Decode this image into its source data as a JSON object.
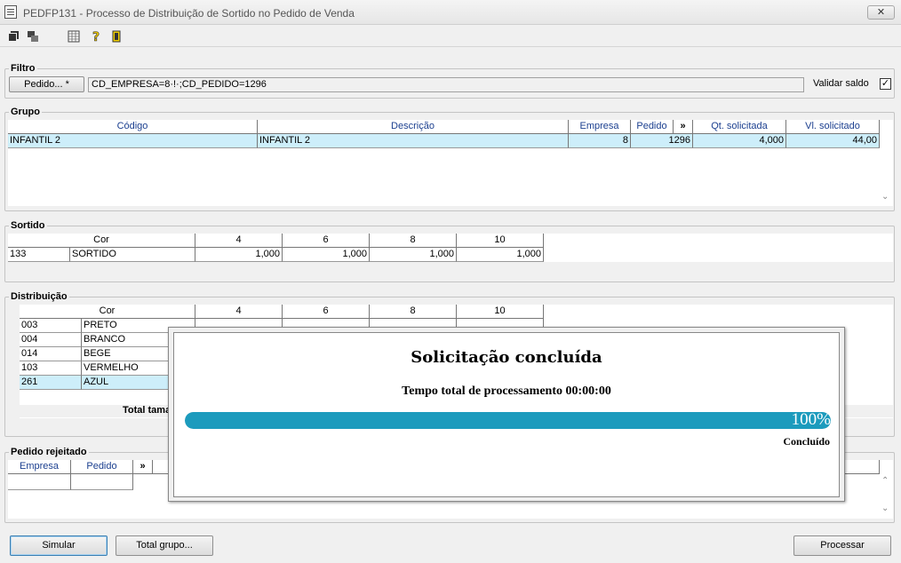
{
  "window": {
    "title": "PEDFP131 - Processo de Distribuição de Sortido no Pedido de Venda",
    "close_glyph": "✕"
  },
  "filtro": {
    "title": "Filtro",
    "pedido_button": "Pedido... *",
    "filter_value": "CD_EMPRESA=8·!·;CD_PEDIDO=1296",
    "validar_label": "Validar saldo",
    "validar_checked": "✓"
  },
  "grupo": {
    "title": "Grupo",
    "columns": [
      "Código",
      "Descrição",
      "Empresa",
      "Pedido",
      "»",
      "Qt. solicitada",
      "Vl. solicitado"
    ],
    "rows": [
      [
        "INFANTIL 2",
        "INFANTIL 2",
        "8",
        "1296",
        "4,000",
        "44,00"
      ]
    ]
  },
  "sortido": {
    "title": "Sortido",
    "columns": [
      "Cor",
      "4",
      "6",
      "8",
      "10"
    ],
    "rows": [
      [
        "133",
        "SORTIDO",
        "1,000",
        "1,000",
        "1,000",
        "1,000"
      ]
    ]
  },
  "distribuicao": {
    "title": "Distribuição",
    "columns": [
      "Cor",
      "4",
      "6",
      "8",
      "10"
    ],
    "rows": [
      [
        "003",
        "PRETO"
      ],
      [
        "004",
        "BRANCO"
      ],
      [
        "014",
        "BEGE"
      ],
      [
        "103",
        "VERMELHO"
      ],
      [
        "261",
        "AZUL"
      ]
    ],
    "total_label": "Total tama"
  },
  "rejeitado": {
    "title": "Pedido rejeitado",
    "columns": [
      "Empresa",
      "Pedido",
      "»"
    ]
  },
  "buttons": {
    "simular": "Simular",
    "total_grupo": "Total grupo...",
    "processar": "Processar"
  },
  "modal": {
    "title": "Solicitação concluída",
    "time": "Tempo total de processamento 00:00:00",
    "percent": "100%",
    "progress": 1.0,
    "status": "Concluído"
  },
  "colors": {
    "progress": "#1c9bbd",
    "selection": "#cdeefa",
    "header_text": "#1b3f8f"
  }
}
